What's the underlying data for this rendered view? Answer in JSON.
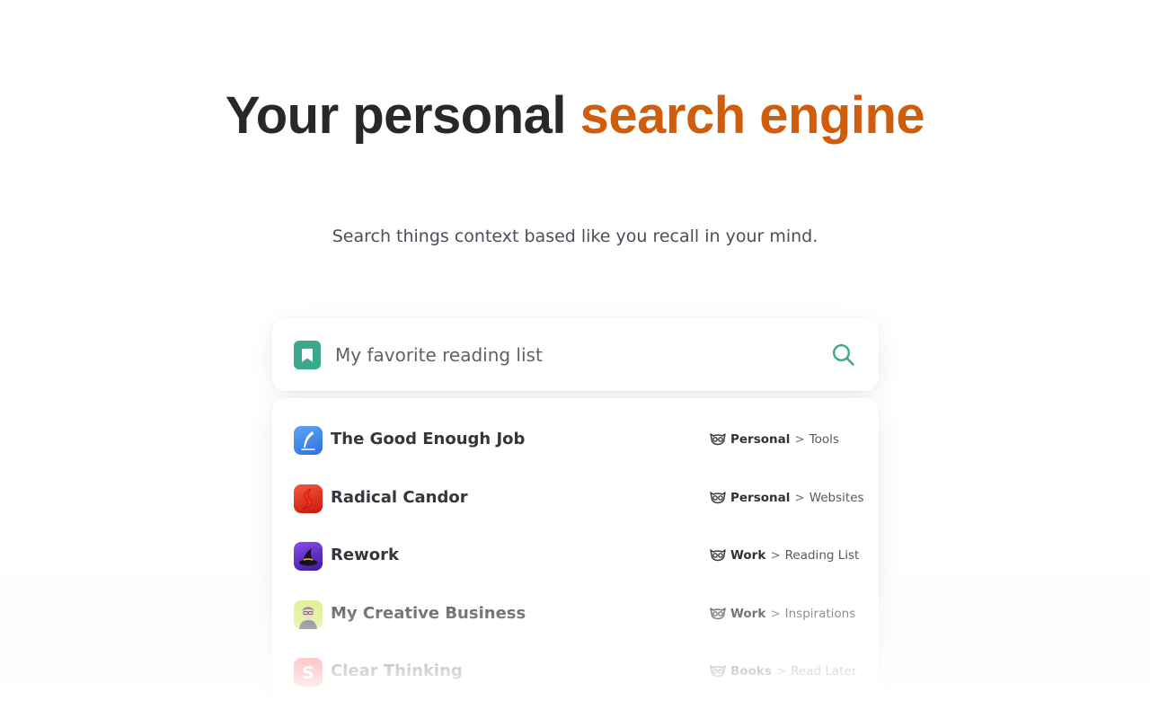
{
  "hero": {
    "title_main": "Your personal ",
    "title_accent": "search engine",
    "subtitle": "Search things context based like you recall in your mind."
  },
  "search": {
    "query": "My favorite reading list",
    "bookmark_icon": "bookmark-icon",
    "search_icon": "search-icon"
  },
  "results": [
    {
      "title": "The Good Enough Job",
      "icon": "feather-app-icon",
      "space": "Personal",
      "folder": "Tools"
    },
    {
      "title": "Radical Candor",
      "icon": "red-ribbon-app-icon",
      "space": "Personal",
      "folder": "Websites"
    },
    {
      "title": "Rework",
      "icon": "witch-hat-app-icon",
      "space": "Work",
      "folder": "Reading List"
    },
    {
      "title": "My Creative Business",
      "icon": "avatar-app-icon",
      "space": "Work",
      "folder": "Inspirations"
    },
    {
      "title": "Clear Thinking",
      "icon": "letter-s-app-icon",
      "space": "Books",
      "folder": "Read Later"
    }
  ],
  "breadcrumb_separator": ">",
  "colors": {
    "accent": "#cf5d0c",
    "brand_green": "#3ba88c",
    "heading": "#26282c"
  }
}
